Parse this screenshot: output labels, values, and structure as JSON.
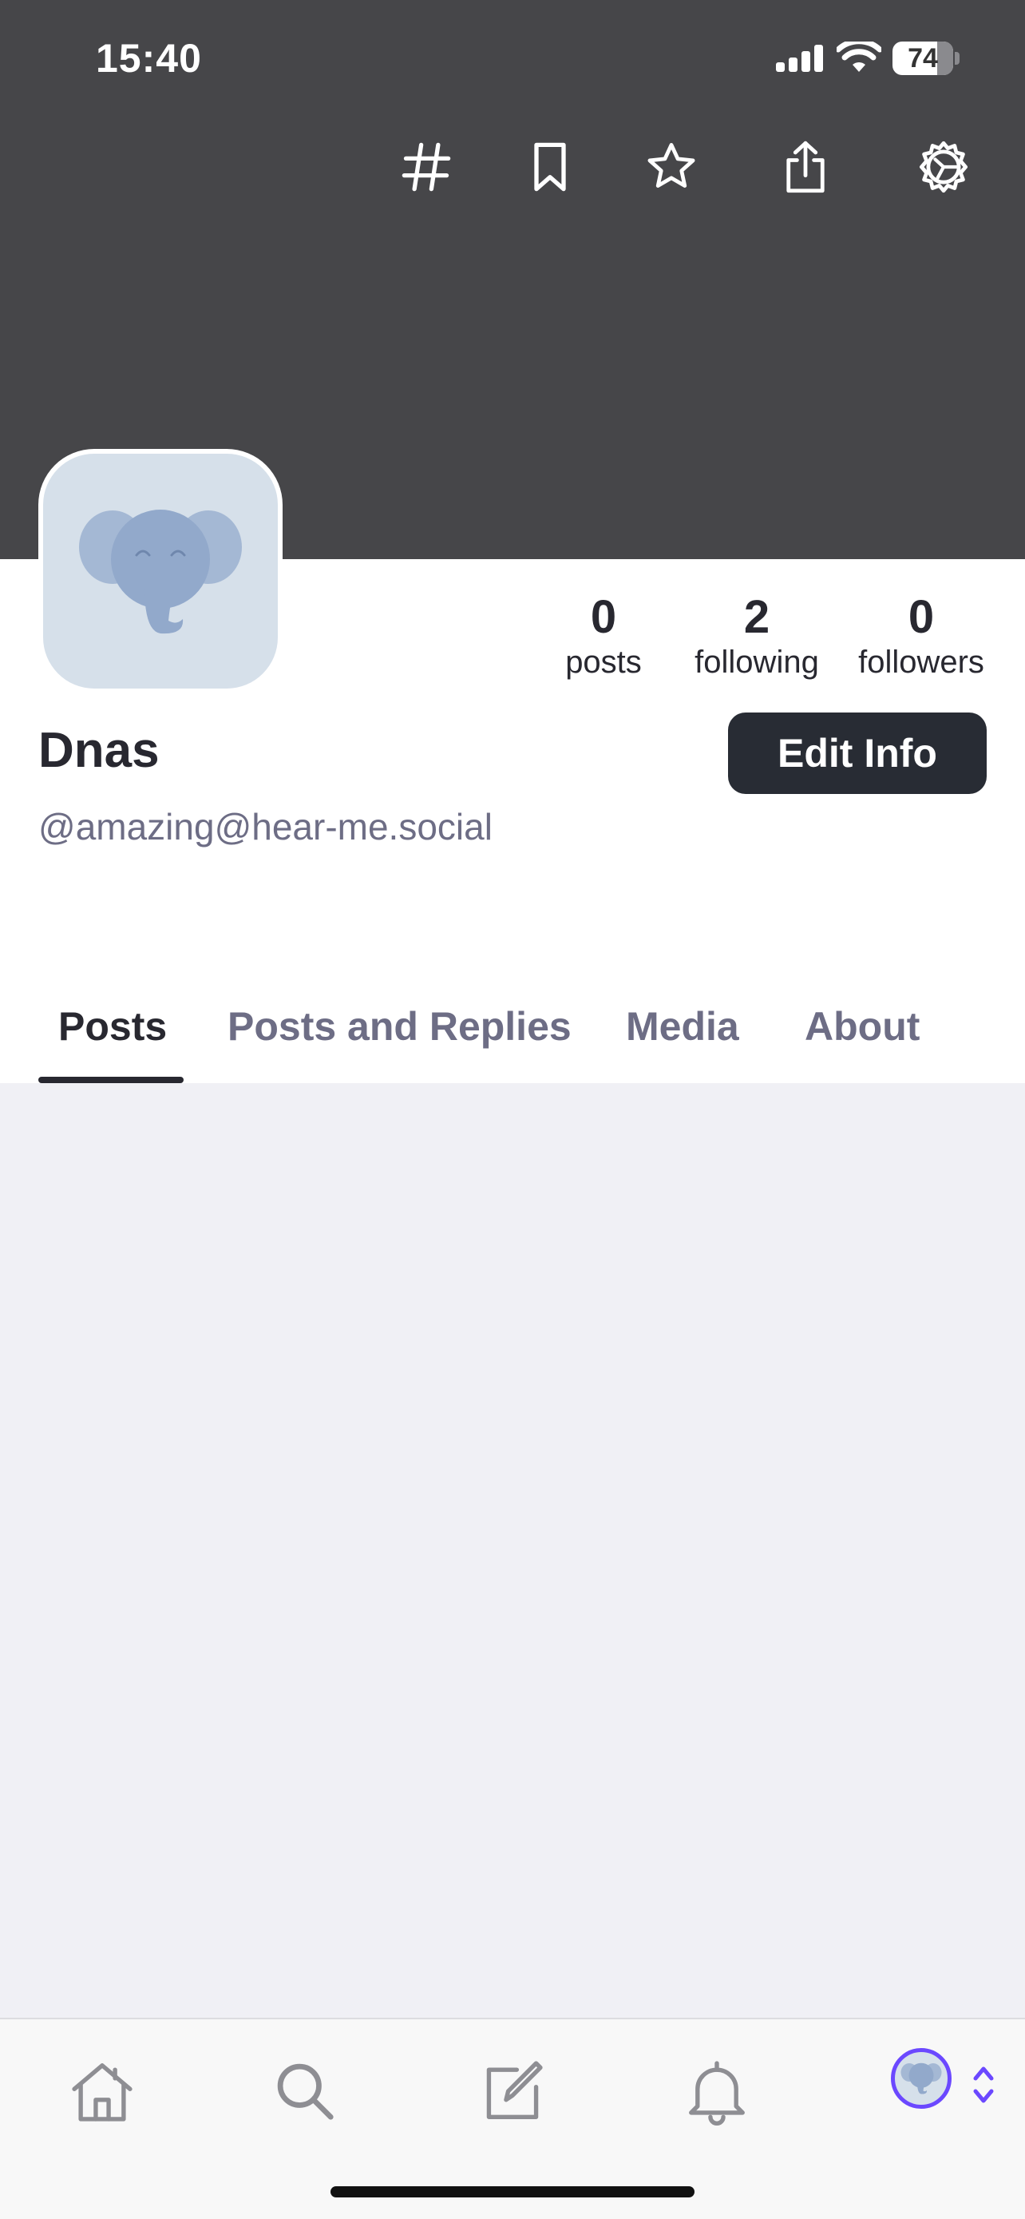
{
  "status_bar": {
    "time": "15:40",
    "battery": "74"
  },
  "header_actions": [
    "hashtag-icon",
    "bookmark-icon",
    "star-icon",
    "share-icon",
    "settings-icon"
  ],
  "profile": {
    "display_name": "Dnas",
    "handle": "@amazing@hear-me.social",
    "edit_button": "Edit Info",
    "stats": {
      "posts": {
        "value": "0",
        "label": "posts"
      },
      "following": {
        "value": "2",
        "label": "following"
      },
      "followers": {
        "value": "0",
        "label": "followers"
      }
    }
  },
  "tabs": [
    {
      "label": "Posts",
      "active": true
    },
    {
      "label": "Posts and Replies",
      "active": false
    },
    {
      "label": "Media",
      "active": false
    },
    {
      "label": "About",
      "active": false
    }
  ],
  "tab_bar": [
    "home-icon",
    "search-icon",
    "compose-icon",
    "bell-icon",
    "account-avatar"
  ],
  "colors": {
    "header_bg": "#464649",
    "accent": "#6b48ff",
    "button_bg": "#282c34",
    "avatar_bg": "#d6e0ea",
    "content_bg": "#f0f0f5"
  }
}
